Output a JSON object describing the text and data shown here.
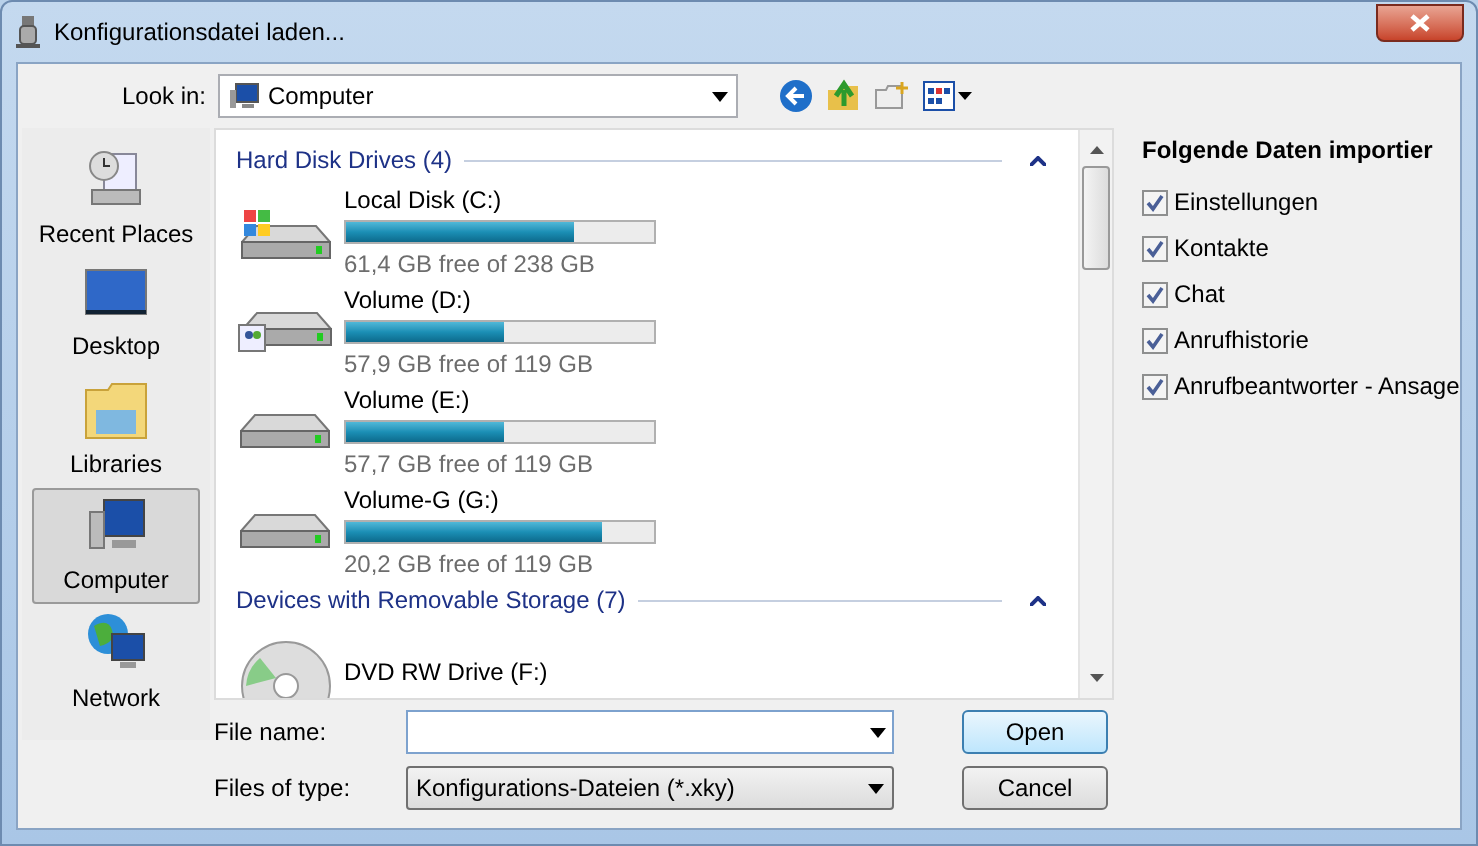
{
  "window": {
    "title": "Konfigurationsdatei laden..."
  },
  "look_in": {
    "label": "Look in:",
    "value": "Computer"
  },
  "places": [
    {
      "label": "Recent Places",
      "kind": "recent",
      "selected": false
    },
    {
      "label": "Desktop",
      "kind": "desktop",
      "selected": false
    },
    {
      "label": "Libraries",
      "kind": "libraries",
      "selected": false
    },
    {
      "label": "Computer",
      "kind": "computer",
      "selected": true
    },
    {
      "label": "Network",
      "kind": "network",
      "selected": false
    }
  ],
  "groups": [
    {
      "title": "Hard Disk Drives (4)",
      "expanded": true,
      "items": [
        {
          "name": "Local Disk (C:)",
          "kind": "system",
          "level": 0.74,
          "free": "61,4 GB free of 238 GB"
        },
        {
          "name": "Volume (D:)",
          "kind": "shared",
          "level": 0.51,
          "free": "57,9 GB free of 119 GB"
        },
        {
          "name": "Volume (E:)",
          "kind": "disk",
          "level": 0.515,
          "free": "57,7 GB free of 119 GB"
        },
        {
          "name": "Volume-G (G:)",
          "kind": "disk",
          "level": 0.83,
          "free": "20,2 GB free of 119 GB"
        }
      ]
    },
    {
      "title": "Devices with Removable Storage (7)",
      "expanded": true,
      "items": [
        {
          "name": "DVD RW Drive (F:)",
          "kind": "dvd"
        }
      ]
    }
  ],
  "file_name": {
    "label": "File name:"
  },
  "file_type": {
    "label": "Files of type:",
    "value": "Konfigurations-Dateien (*.xky)"
  },
  "buttons": [
    "Open",
    "Cancel"
  ],
  "import_panel": {
    "title": "Folgende Daten importier",
    "options": [
      {
        "label": "Einstellungen",
        "checked": true
      },
      {
        "label": "Kontakte",
        "checked": true
      },
      {
        "label": "Chat",
        "checked": true
      },
      {
        "label": "Anrufhistorie",
        "checked": true
      },
      {
        "label": "Anrufbeantworter - Ansage",
        "checked": true
      }
    ]
  }
}
